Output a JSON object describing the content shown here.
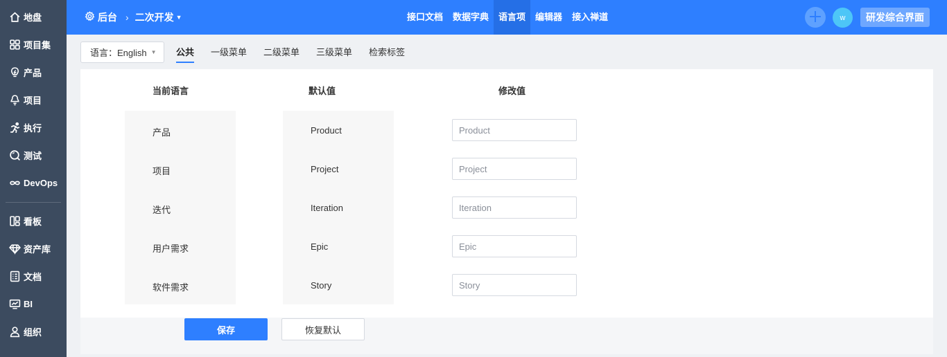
{
  "sidebar": {
    "items": [
      {
        "label": "地盘",
        "icon": "home-icon"
      },
      {
        "label": "项目集",
        "icon": "grid-icon"
      },
      {
        "label": "产品",
        "icon": "lightbulb-icon"
      },
      {
        "label": "项目",
        "icon": "project-icon"
      },
      {
        "label": "执行",
        "icon": "run-icon"
      },
      {
        "label": "测试",
        "icon": "test-icon"
      },
      {
        "label": "DevOps",
        "icon": "infinity-icon"
      }
    ],
    "items2": [
      {
        "label": "看板",
        "icon": "kanban-icon"
      },
      {
        "label": "资产库",
        "icon": "diamond-icon"
      },
      {
        "label": "文档",
        "icon": "doc-icon"
      },
      {
        "label": "BI",
        "icon": "monitor-icon"
      },
      {
        "label": "组织",
        "icon": "user-icon"
      }
    ]
  },
  "header": {
    "breadcrumb_root": "后台",
    "breadcrumb_current": "二次开发",
    "nav": [
      "接口文档",
      "数据字典",
      "语言项",
      "编辑器",
      "接入禅道"
    ],
    "active_nav": "语言项",
    "avatar_text": "w",
    "switch_label": "研发综合界面"
  },
  "subnav": {
    "language_label": "语言：English",
    "tabs": [
      "公共",
      "一级菜单",
      "二级菜单",
      "三级菜单",
      "检索标签"
    ],
    "active_tab": "公共"
  },
  "table": {
    "headers": {
      "current": "当前语言",
      "default": "默认值",
      "modified": "修改值"
    },
    "rows": [
      {
        "current": "产品",
        "default": "Product",
        "placeholder": "Product"
      },
      {
        "current": "项目",
        "default": "Project",
        "placeholder": "Project"
      },
      {
        "current": "迭代",
        "default": "Iteration",
        "placeholder": "Iteration"
      },
      {
        "current": "用户需求",
        "default": "Epic",
        "placeholder": "Epic"
      },
      {
        "current": "软件需求",
        "default": "Story",
        "placeholder": "Story"
      }
    ]
  },
  "actions": {
    "save": "保存",
    "reset": "恢复默认"
  },
  "colors": {
    "primary": "#2e7fff",
    "sidebar": "#3c4b5f"
  }
}
